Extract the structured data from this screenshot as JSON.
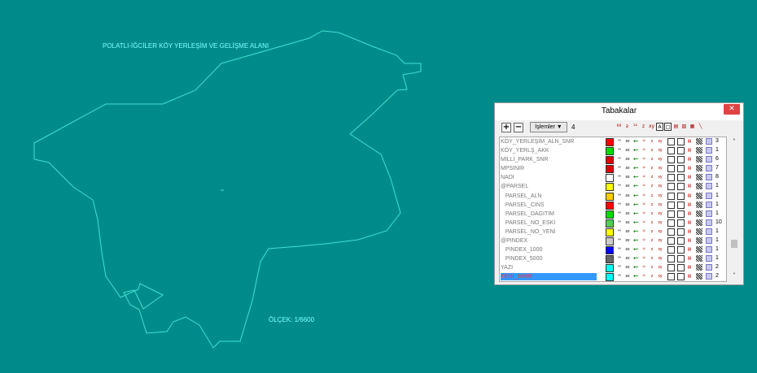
{
  "map": {
    "title_label": "POLATLI-İĞCİLER KÖY YERLEŞİM VE GELİŞME ALANI",
    "scale_label": "ÖLÇEK: 1/6600",
    "boundary_color": "#40e0d0",
    "background_color": "#008b8b"
  },
  "panel": {
    "title": "Tabakalar",
    "close_icon": "close-icon",
    "toolbar": {
      "add_icon": "plus-icon",
      "remove_icon": "minus-icon",
      "ops_label": "İşlemler ▼",
      "count": "4"
    },
    "layers": [
      {
        "name": "KÖY_YERLEŞİM_ALN_SNR",
        "color": "#ff0000",
        "count": "3",
        "selected": false
      },
      {
        "name": "KÖY_YERLŞ_AKK",
        "color": "#00dd00",
        "count": "1",
        "selected": false
      },
      {
        "name": "MİLLİ_PARK_SNR",
        "color": "#dd0000",
        "count": "6",
        "selected": false
      },
      {
        "name": "MPSINIR",
        "color": "#dd0000",
        "count": "7",
        "selected": false
      },
      {
        "name": "NADI",
        "color": "#ffffff",
        "count": "8",
        "selected": false
      },
      {
        "name": "@PARSEL",
        "color": "#ffff00",
        "count": "1",
        "selected": false
      },
      {
        "name": "   PARSEL_ALN",
        "color": "#ffcc00",
        "count": "1",
        "selected": false
      },
      {
        "name": "   PARSEL_CINS",
        "color": "#ff0000",
        "count": "1",
        "selected": false
      },
      {
        "name": "   PARSEL_DAGITIM",
        "color": "#00dd00",
        "count": "1",
        "selected": false
      },
      {
        "name": "   PARSEL_NO_ESKİ",
        "color": "#55cc55",
        "count": "10",
        "selected": false
      },
      {
        "name": "   PARSEL_NO_YENİ",
        "color": "#ffff00",
        "count": "1",
        "selected": false
      },
      {
        "name": "@PINDEX",
        "color": "#cccccc",
        "count": "1",
        "selected": false
      },
      {
        "name": "   PINDEX_1000",
        "color": "#0000ff",
        "count": "1",
        "selected": false
      },
      {
        "name": "   PINDEX_5000",
        "color": "#666666",
        "count": "1",
        "selected": false
      },
      {
        "name": "YAZI",
        "color": "#00ffff",
        "count": "2",
        "selected": false
      },
      {
        "name": "YENİ_SINIR",
        "color": "#00ffff",
        "count": "2",
        "selected": true
      }
    ]
  }
}
